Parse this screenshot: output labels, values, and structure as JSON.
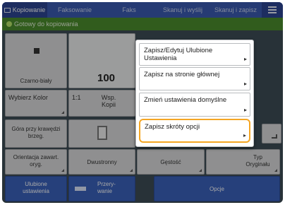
{
  "header": {
    "tabs": [
      {
        "label": "Kopiowanie",
        "active": true
      },
      {
        "label": "Faksowanie",
        "active": false
      },
      {
        "label": "Faks",
        "active": false
      },
      {
        "label": "Skanuj i wyślij",
        "active": false
      },
      {
        "label": "Skanuj i zapisz",
        "active": false
      }
    ],
    "menu_icon": "hamburger-icon"
  },
  "status": {
    "text": "Gotowy do kopiowania",
    "color": "#4b8c2d"
  },
  "color_tile": {
    "label": "Czarno-biały"
  },
  "copies": {
    "value": "100"
  },
  "select_color": {
    "label": "Wybierz Kolor"
  },
  "ratio": {
    "value": "1:1",
    "label": "Wsp. Kopii"
  },
  "edge": {
    "label": "Góra przy krawędzi brzeg."
  },
  "orientation": {
    "label": "Orientacja zawart. oryg."
  },
  "duplex": {
    "label": "Dwustronny"
  },
  "density": {
    "label": "Gęstość"
  },
  "original_type": {
    "label": "Typ Oryginału"
  },
  "favorites": {
    "label": "Ulubione ustawienia"
  },
  "interrupt": {
    "label": "Przery-wanie"
  },
  "options": {
    "label": "Opcje"
  },
  "popup": {
    "items": [
      {
        "label": "Zapisz/Edytuj Ulubione Ustawienia",
        "highlighted": false
      },
      {
        "label": "Zapisz na stronie głównej",
        "highlighted": false
      },
      {
        "label": "Zmień ustawienia domyślne",
        "highlighted": false
      },
      {
        "label": "Zapisz skróty opcji",
        "highlighted": true
      }
    ]
  },
  "colors": {
    "accent": "#f5a623",
    "header": "#3a5ab0",
    "tile_blue": "#3a62bb"
  }
}
